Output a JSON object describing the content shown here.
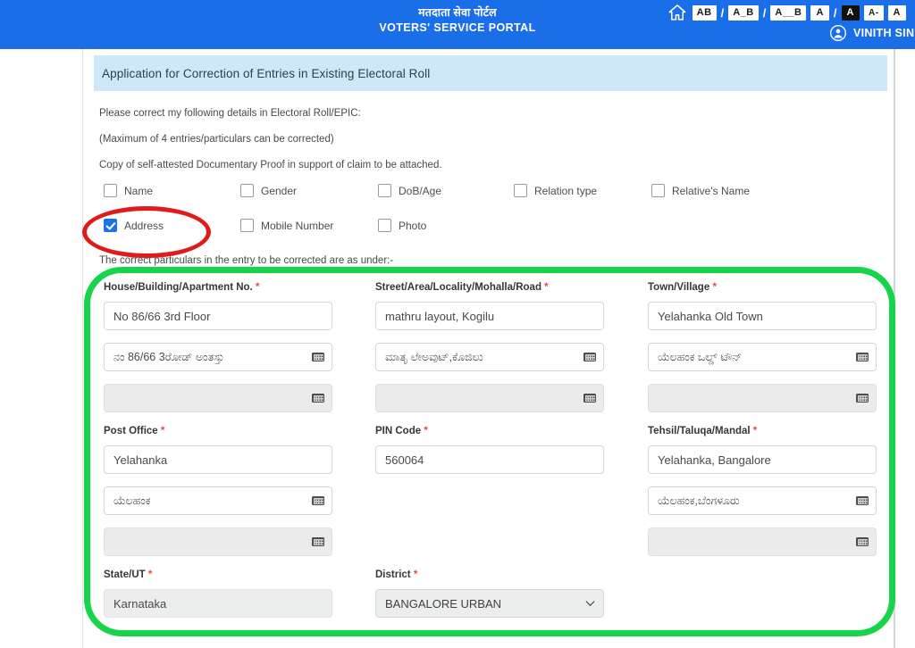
{
  "topbar": {
    "brand_hindi": "मतदाता सेवा पोर्टल",
    "brand_english": "VOTERS' SERVICE PORTAL",
    "home_icon": "home-icon",
    "user_icon": "account-circle-icon",
    "user_name": "VINITH SIN",
    "accent_color": "#1a6ee8",
    "letter_spacing_controls": [
      {
        "name": "letter-spacing-normal",
        "label": "AB"
      },
      {
        "name": "separator-1",
        "label": "/"
      },
      {
        "name": "letter-spacing-medium",
        "label": "A_B"
      },
      {
        "name": "separator-2",
        "label": "/"
      },
      {
        "name": "letter-spacing-wide",
        "label": "A__B"
      }
    ],
    "contrast_controls": [
      {
        "name": "contrast-normal",
        "label": "A"
      },
      {
        "name": "separator-3",
        "label": "/"
      },
      {
        "name": "contrast-inverted",
        "label": "A"
      }
    ],
    "font_size_controls": [
      {
        "name": "font-size-decrease",
        "label": "A-"
      },
      {
        "name": "font-size-default",
        "label": "A"
      }
    ]
  },
  "banner": {
    "title": "Application for Correction of Entries in Existing Electoral Roll",
    "background": "#cfe8f7"
  },
  "notes": {
    "line1": "Please correct my following details in Electoral Roll/EPIC:",
    "line2": "(Maximum of 4 entries/particulars can be corrected)",
    "line3": "Copy of self-attested Documentary Proof in support of claim to be attached.",
    "line4": "The correct particulars in the entry to be corrected are as under:-"
  },
  "correction_checkboxes": [
    {
      "name": "checkbox-name",
      "label": "Name",
      "checked": false
    },
    {
      "name": "checkbox-gender",
      "label": "Gender",
      "checked": false
    },
    {
      "name": "checkbox-dob-age",
      "label": "DoB/Age",
      "checked": false
    },
    {
      "name": "checkbox-relation-type",
      "label": "Relation type",
      "checked": false
    },
    {
      "name": "checkbox-relatives-name",
      "label": "Relative's Name",
      "checked": false
    },
    {
      "name": "checkbox-address",
      "label": "Address",
      "checked": true
    },
    {
      "name": "checkbox-mobile-number",
      "label": "Mobile Number",
      "checked": false
    },
    {
      "name": "checkbox-photo",
      "label": "Photo",
      "checked": false
    }
  ],
  "form": {
    "house": {
      "label": "House/Building/Apartment No.",
      "required": "*",
      "value": "No 86/66 3rd Floor",
      "translit_value": "ನಂ 86/66 3ರೋಡ್ ಅಂತಸ್ತು",
      "extra_value": ""
    },
    "street": {
      "label": "Street/Area/Locality/Mohalla/Road",
      "required": "*",
      "value": "mathru layout, Kogilu",
      "translit_value": "ಮಾತೃ ಲೇಅವುಟ್,ಕೊಜಿಲು",
      "extra_value": ""
    },
    "town": {
      "label": "Town/Village",
      "required": "*",
      "value": "Yelahanka Old Town",
      "translit_value": "ಯೆಲಹಂಕ ಒಲ್ಡ್ ಟೌನ್",
      "extra_value": ""
    },
    "post_office": {
      "label": "Post Office",
      "required": "*",
      "value": "Yelahanka",
      "translit_value": "ಯೆಲಹಂಕ",
      "extra_value": ""
    },
    "pin_code": {
      "label": "PIN Code",
      "required": "*",
      "value": "560064"
    },
    "tehsil": {
      "label": "Tehsil/Taluqa/Mandal",
      "required": "*",
      "value": "Yelahanka, Bangalore",
      "translit_value": "ಯೆಲಹಂಕ,ಬೆಂಗಳೂರು",
      "extra_value": ""
    },
    "state": {
      "label": "State/UT",
      "required": "*",
      "value": "Karnataka"
    },
    "district": {
      "label": "District",
      "required": "*",
      "value": "BANGALORE URBAN"
    },
    "keyboard_icon": "virtual-keyboard-icon"
  },
  "annotations": {
    "address_highlight": {
      "name": "red-ellipse-annotation",
      "color": "#e01b1b"
    },
    "address_fields_highlight": {
      "name": "green-rectangle-annotation",
      "color": "#18d44a"
    }
  }
}
